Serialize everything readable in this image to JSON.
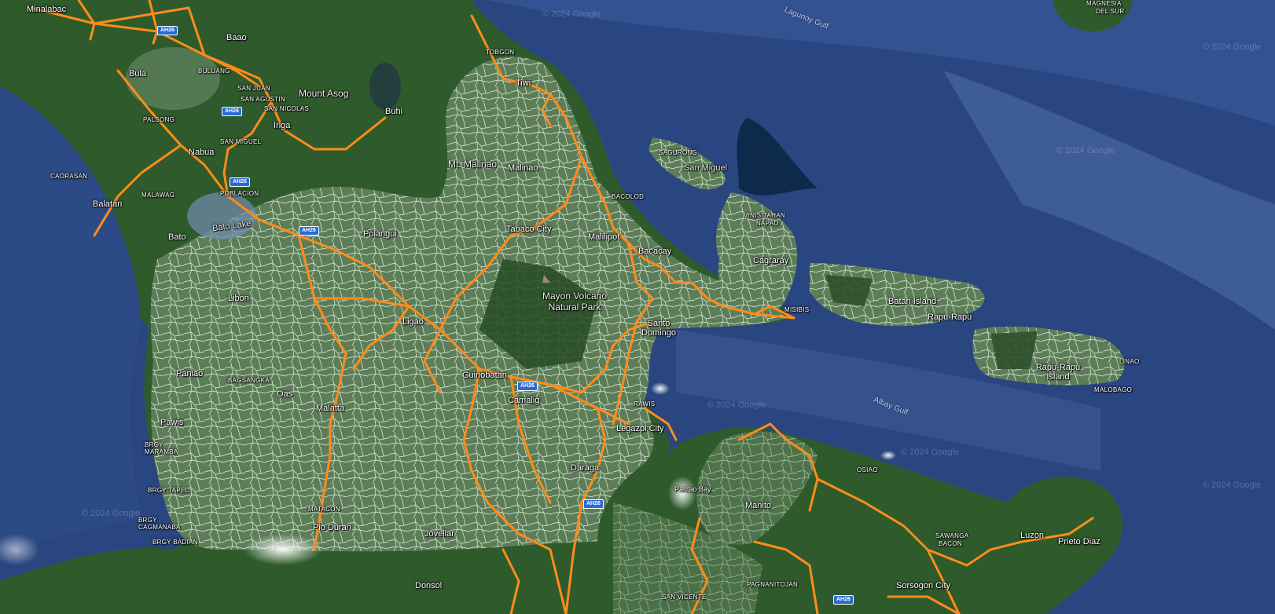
{
  "map": {
    "colors": {
      "sea": "#2a4680",
      "deep_sea": "#1b3166",
      "land": "#2f5a2c",
      "land_dark": "#234822",
      "parcels": "#a9c7a6",
      "roads": "#ff8c1a",
      "shield": "#2a6ad6"
    },
    "watermark": "© 2024 Google",
    "water_labels": {
      "lagonoy_gulf": "Lagunoy Gulf",
      "albay_gulf": "Albay Gulf"
    },
    "labels": {
      "minalabac": "Minalabac",
      "baao": "Baao",
      "bula": "Bula",
      "buluang": "BULUANG",
      "san_juan": "SAN JUAN",
      "san_agustin": "SAN AGUSTIN",
      "san_nicolas": "SAN NICOLAS",
      "mount_asog": "Mount Asog",
      "buhi": "Buhi",
      "iriga": "Iriga",
      "palsong": "PALSONG",
      "nabua": "Nabua",
      "san_miguel_brgy": "SAN MIGUEL",
      "caorasan": "CAORASAN",
      "malawag": "MALAWAG",
      "poblacion": "POBLACION",
      "balatan": "Balatan",
      "bato_lake": "Bato Lake",
      "bato": "Bato",
      "polangui": "Polangui",
      "mt_malinao": "Mt. Malinao",
      "malinao": "Malinao",
      "tiwi": "Tiwi",
      "tobgon": "TOBGON",
      "tabaco_city": "Tabaco City",
      "bacolod": "BACOLOD",
      "malilipot": "Malilipot",
      "bacacay": "Bacacay",
      "sagurong": "SAGURONG",
      "san_miguel": "San Miguel",
      "visitahan": "VINISITAHAN",
      "napao": "NAPAO",
      "batan_island": "Batan Island",
      "rapu_rapu": "Rapu-Rapu",
      "rapu_rapu_island": "Rapu-Rapu Island",
      "linao": "LINAO",
      "malobago": "MALOBAGO",
      "misibis": "MISIBIS",
      "cagraray": "Cagraray",
      "mayon": "Mayon Volcano Natural Park",
      "santo_domingo": "Santo Domingo",
      "libon": "Libon",
      "ligao": "Ligao",
      "guinobatan": "Guinobatan",
      "camalig": "Camalig",
      "legazpi": "Legazpi City",
      "daraga": "Daraga",
      "rawis": "RAWIS",
      "bagsangka": "BAGSANGKA",
      "oas": "Oas",
      "panlao": "Panlao",
      "malatta": "Malatta",
      "pawa": "Pawis",
      "brgy_maramba": "BRGY MARAMBA",
      "brgy_tapel": "BRGY TAPEL",
      "cagmanaba": "BRGY CAGMANABA",
      "brgy_badian": "BRGY BADIAN",
      "matacon": "MATACON",
      "pio_duran": "Pio Duran",
      "jovellar": "Jovellar",
      "donsol": "Donsol",
      "manito": "Manito",
      "pantao_bay": "Pantao Bay",
      "osiao": "OSIAO",
      "pagnanitojan": "PAGNANITOJAN",
      "san_vicente": "SAN VICENTE",
      "sorsogon_city": "Sorsogon City",
      "luzon": "Luzon",
      "prieto_diaz": "Prieto Diaz",
      "bacon": "BACON",
      "sawanga": "SAWANGA",
      "magnesia": "MAGNESIA",
      "del_sur": "DEL SUR"
    },
    "shields": [
      "AH26",
      "AH26",
      "AH26",
      "AH26",
      "AH26",
      "AH26",
      "AH26"
    ]
  }
}
